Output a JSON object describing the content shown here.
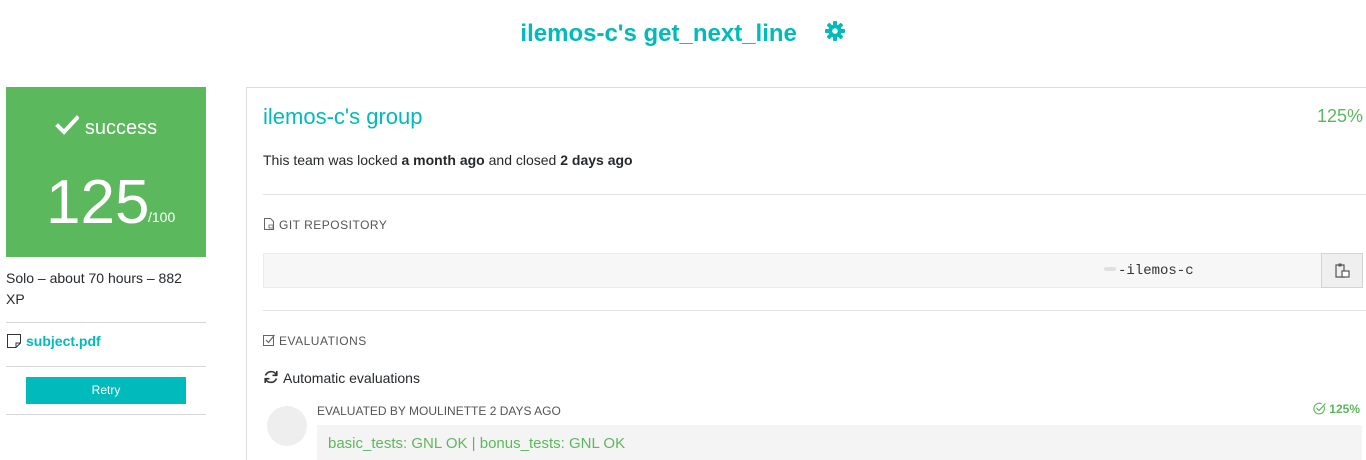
{
  "header": {
    "title": "ilemos-c's get_next_line",
    "icons": {
      "settings": "gear-icon"
    }
  },
  "score_card": {
    "status": "success",
    "score": "125",
    "max": "/100",
    "background_color": "#5cb85c",
    "icon": "checkmark-icon"
  },
  "project_info": {
    "text": "Solo – about 70 hours – 882 XP"
  },
  "subject": {
    "label": "subject.pdf",
    "icon": "document-icon"
  },
  "retry": {
    "label": "Retry"
  },
  "team": {
    "title": "ilemos-c's group",
    "final_mark": "125%",
    "status_prefix": "This team was locked ",
    "locked_when": "a month ago",
    "status_middle": " and closed ",
    "closed_when": "2 days ago"
  },
  "git_repository": {
    "label": "GIT REPOSITORY",
    "icon": "file-icon",
    "url_visible": "-ilemos-c",
    "copy_icon": "clipboard-icon"
  },
  "evaluations": {
    "label": "EVALUATIONS",
    "icon": "checkbox-icon",
    "automatic_label": "Automatic evaluations",
    "automatic_icon": "refresh-icon",
    "items": [
      {
        "evaluator": "EVALUATED BY MOULINETTE 2 DAYS AGO",
        "mark": "125%",
        "result": "basic_tests: GNL OK | bonus_tests: GNL OK"
      }
    ]
  },
  "colors": {
    "accent": "#00babc",
    "success": "#5cb85c"
  }
}
